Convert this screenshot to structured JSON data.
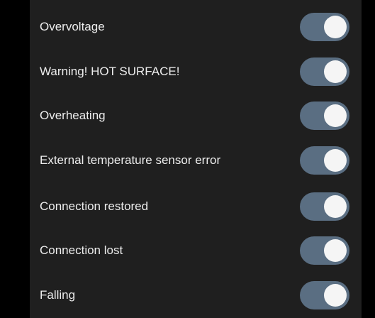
{
  "settings": [
    {
      "label": "Overvoltage",
      "enabled": true
    },
    {
      "label": "Warning! HOT SURFACE!",
      "enabled": true
    },
    {
      "label": "Overheating",
      "enabled": true
    },
    {
      "label": "External temperature sensor error",
      "enabled": true
    },
    {
      "label": "Connection restored",
      "enabled": true
    },
    {
      "label": "Connection lost",
      "enabled": true
    },
    {
      "label": "Falling",
      "enabled": true
    }
  ],
  "colors": {
    "background": "#000000",
    "panel": "#1f1f1f",
    "text": "#ededed",
    "toggle_track_on": "#5a6e82",
    "toggle_knob": "#f5f5f5"
  }
}
